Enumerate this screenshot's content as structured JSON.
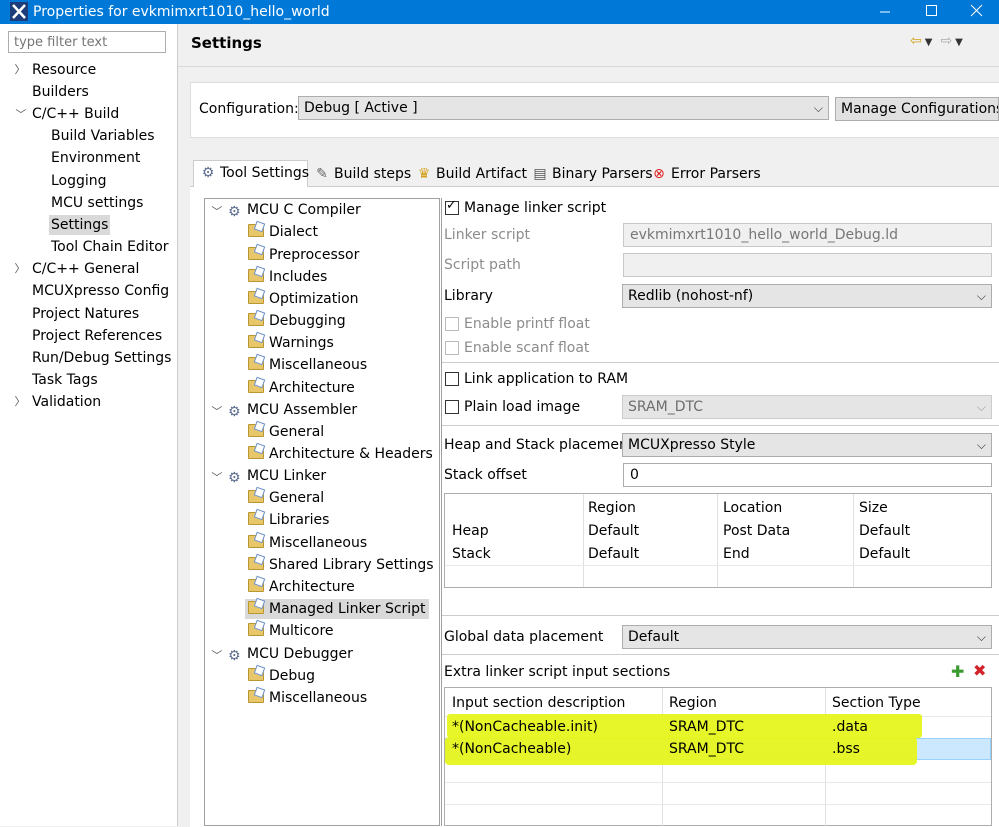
{
  "window": {
    "title": "Properties for evkmimxrt1010_hello_world"
  },
  "filter": {
    "placeholder": "type filter text"
  },
  "sidebar": {
    "items": [
      {
        "label": "Resource"
      },
      {
        "label": "Builders"
      },
      {
        "label": "C/C++ Build"
      },
      {
        "label": "Build Variables"
      },
      {
        "label": "Environment"
      },
      {
        "label": "Logging"
      },
      {
        "label": "MCU settings"
      },
      {
        "label": "Settings"
      },
      {
        "label": "Tool Chain Editor"
      },
      {
        "label": "C/C++ General"
      },
      {
        "label": "MCUXpresso Config T"
      },
      {
        "label": "Project Natures"
      },
      {
        "label": "Project References"
      },
      {
        "label": "Run/Debug Settings"
      },
      {
        "label": "Task Tags"
      },
      {
        "label": "Validation"
      }
    ],
    "selected": "Settings"
  },
  "header": {
    "title": "Settings"
  },
  "configuration": {
    "label": "Configuration:",
    "value": "Debug  [ Active ]",
    "manage_label": "Manage Configurations..."
  },
  "tabs": [
    {
      "label": "Tool Settings"
    },
    {
      "label": "Build steps"
    },
    {
      "label": "Build Artifact"
    },
    {
      "label": "Binary Parsers"
    },
    {
      "label": "Error Parsers"
    }
  ],
  "tree": {
    "groups": [
      {
        "label": "MCU C Compiler",
        "children": [
          "Dialect",
          "Preprocessor",
          "Includes",
          "Optimization",
          "Debugging",
          "Warnings",
          "Miscellaneous",
          "Architecture"
        ]
      },
      {
        "label": "MCU Assembler",
        "children": [
          "General",
          "Architecture & Headers"
        ]
      },
      {
        "label": "MCU Linker",
        "children": [
          "General",
          "Libraries",
          "Miscellaneous",
          "Shared Library Settings",
          "Architecture",
          "Managed Linker Script",
          "Multicore"
        ]
      },
      {
        "label": "MCU Debugger",
        "children": [
          "Debug",
          "Miscellaneous"
        ]
      }
    ],
    "selected": "Managed Linker Script"
  },
  "linker": {
    "manage_linker_script": {
      "label": "Manage linker script",
      "checked": true
    },
    "linker_script": {
      "label": "Linker script",
      "value": "evkmimxrt1010_hello_world_Debug.ld"
    },
    "script_path": {
      "label": "Script path",
      "value": ""
    },
    "library": {
      "label": "Library",
      "value": "Redlib (nohost-nf)"
    },
    "enable_printf_float": {
      "label": "Enable printf float",
      "checked": false
    },
    "enable_scanf_float": {
      "label": "Enable scanf float",
      "checked": false
    },
    "link_to_ram": {
      "label": "Link application to RAM",
      "checked": false
    },
    "plain_load_image": {
      "label": "Plain load image",
      "checked": false,
      "value": "SRAM_DTC"
    },
    "heap_stack_placement": {
      "label": "Heap and Stack placement",
      "value": "MCUXpresso Style"
    },
    "stack_offset": {
      "label": "Stack offset",
      "value": "0"
    },
    "heap_stack_table": {
      "columns": [
        "",
        "Region",
        "Location",
        "Size"
      ],
      "rows": [
        [
          "Heap",
          "Default",
          "Post Data",
          "Default"
        ],
        [
          "Stack",
          "Default",
          "End",
          "Default"
        ]
      ]
    },
    "global_data_placement": {
      "label": "Global data placement",
      "value": "Default"
    },
    "extra_sections": {
      "label": "Extra linker script input sections",
      "columns": [
        "Input section description",
        "Region",
        "Section Type"
      ],
      "rows": [
        [
          "*(NonCacheable.init)",
          "SRAM_DTC",
          ".data"
        ],
        [
          "*(NonCacheable)",
          "SRAM_DTC",
          ".bss"
        ]
      ]
    }
  },
  "colors": {
    "titlebar": "#0078d7",
    "highlight": "#e6f51d",
    "selection": "#cce8ff"
  }
}
